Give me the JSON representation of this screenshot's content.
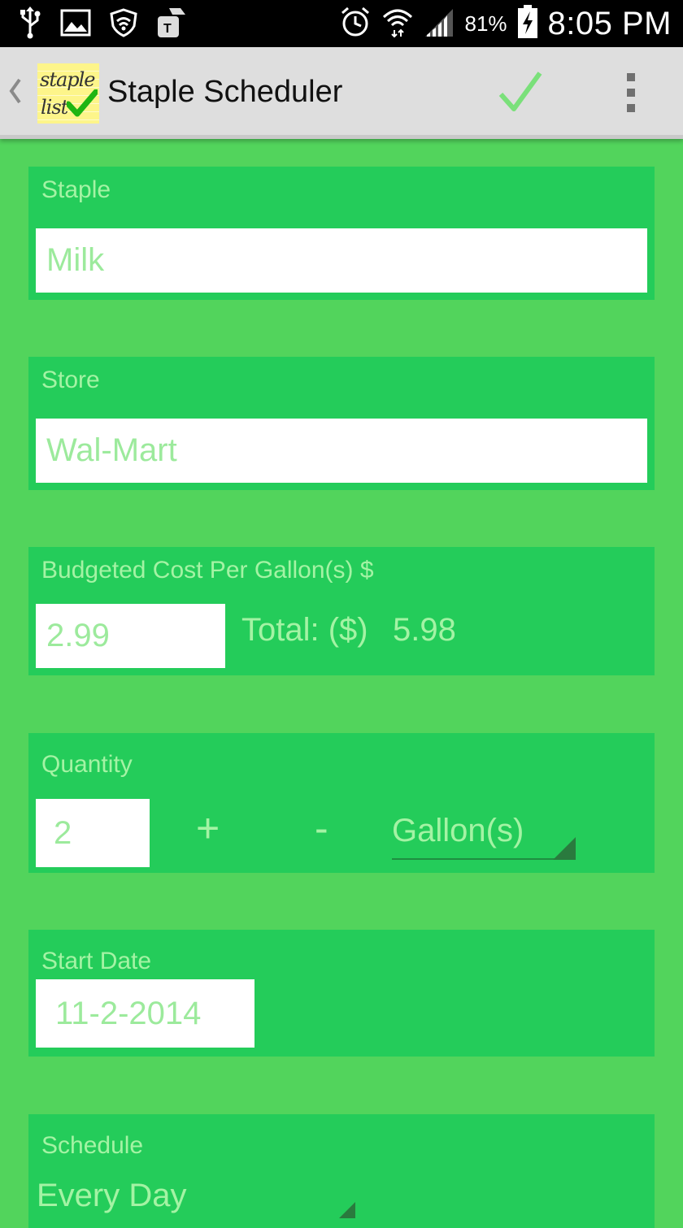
{
  "status_bar": {
    "battery_percent": "81%",
    "time": "8:05 PM",
    "left_icons": [
      "usb-icon",
      "image-icon",
      "wifi-shield-icon",
      "tmobile-icon"
    ],
    "right_icons": [
      "alarm-icon",
      "wifi-icon",
      "signal-icon",
      "battery-charging-icon"
    ]
  },
  "action_bar": {
    "logo_line1": "staple",
    "logo_line2": "list",
    "title": "Staple Scheduler",
    "done_icon": "checkmark-icon",
    "menu_icon": "overflow-menu-icon"
  },
  "form": {
    "staple": {
      "label": "Staple",
      "value": "Milk"
    },
    "store": {
      "label": "Store",
      "value": "Wal-Mart"
    },
    "budget": {
      "label": "Budgeted Cost Per Gallon(s) $",
      "value": "2.99",
      "total_label": "Total: ($)",
      "total_value": "5.98"
    },
    "quantity": {
      "label": "Quantity",
      "value": "2",
      "plus": "+",
      "minus": "-",
      "unit": "Gallon(s)"
    },
    "start_date": {
      "label": "Start Date",
      "value": "11-2-2014"
    },
    "schedule": {
      "label": "Schedule",
      "value": "Every Day"
    }
  },
  "colors": {
    "background": "#52d45c",
    "card": "#24cc5a",
    "label_text": "#a4f3a4",
    "action_bar": "#dedede",
    "checkmark": "#7ae07a"
  }
}
